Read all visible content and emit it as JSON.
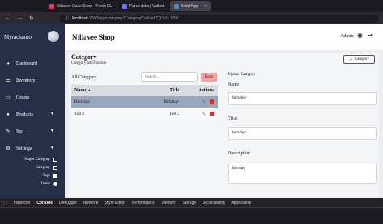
{
  "browser": {
    "tabs": [
      {
        "label": "Nillavee Cake Shop - Fresh Cu",
        "color": "#e8365d"
      },
      {
        "label": "Parse data | Valibot",
        "color": "#6c6cff"
      },
      {
        "label": "Solid App",
        "color": "#4f88c6"
      }
    ],
    "url_host": "localhost",
    "url_path": ":3000/app/category?CategoryCode=37QZo2-16561"
  },
  "sidebar": {
    "brand": "Myrachanto",
    "items": [
      {
        "label": "Dashboard",
        "icon": "dashboard-icon"
      },
      {
        "label": "Inventory",
        "icon": "list-icon"
      },
      {
        "label": "Orders",
        "icon": "orders-icon"
      },
      {
        "label": "Products",
        "icon": "products-icon",
        "caret": true
      },
      {
        "label": "Seo",
        "icon": "seo-icon",
        "caret": true
      },
      {
        "label": "Settings",
        "icon": "settings-icon",
        "caret": true
      }
    ],
    "sub_items": [
      {
        "label": "Major Category"
      },
      {
        "label": "Category"
      },
      {
        "label": "Tags"
      },
      {
        "label": "Users"
      }
    ]
  },
  "header": {
    "title": "Nillavee Shop",
    "admin": "Admin"
  },
  "page": {
    "title": "Category",
    "subtitle": "Category information",
    "add_button": "Category",
    "list_title": "All Category",
    "search_placeholder": "Search ...",
    "reset": "Reset"
  },
  "table": {
    "headers": {
      "name": "Name",
      "title": "Title",
      "actions": "Actions"
    },
    "rows": [
      {
        "name": "Birthdays",
        "title": "Birthdays"
      },
      {
        "name": "Test 2",
        "title": "Test 2"
      }
    ]
  },
  "form": {
    "title": "Update Category",
    "name_label": "Name",
    "name_value": "birthdays",
    "title_label": "Title",
    "title_value": "birthdays",
    "description_label": "Description",
    "description_value": "birthday"
  },
  "devtools": {
    "tabs": [
      "Inspector",
      "Console",
      "Debugger",
      "Network",
      "Style Editor",
      "Performance",
      "Memory",
      "Storage",
      "Accessibility",
      "Application"
    ]
  }
}
